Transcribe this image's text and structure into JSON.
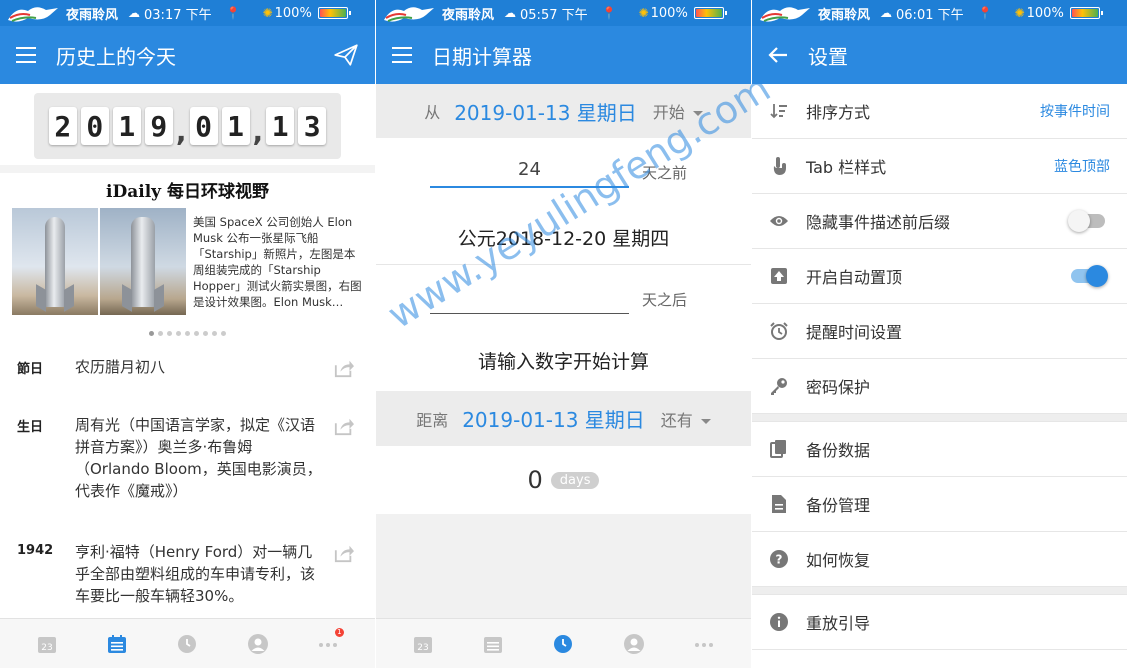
{
  "status_bars": [
    {
      "carrier": "夜雨聆风",
      "time": "03:17 下午",
      "battery": "100%"
    },
    {
      "carrier": "夜雨聆风",
      "time": "05:57 下午",
      "battery": "100%"
    },
    {
      "carrier": "夜雨聆风",
      "time": "06:01 下午",
      "battery": "100%"
    }
  ],
  "history": {
    "title": "历史上的今天",
    "date_digits": [
      "2",
      "0",
      "1",
      "9",
      "0",
      "1",
      "1",
      "3"
    ],
    "date_separator": ",",
    "card_title": "iDaily 每日环球视野",
    "card_text": "美国 SpaceX 公司创始人 Elon Musk 公布一张星际飞船「Starship」新照片，左图是本周组装完成的「Starship Hopper」测试火箭实景图，右图是设计效果图。Elon Musk…",
    "carousel": {
      "count": 9,
      "active": 0
    },
    "events": [
      {
        "label": "節日",
        "text": "农历腊月初八"
      },
      {
        "label": "生日",
        "text": "周有光（中国语言学家，拟定《汉语拼音方案》）奥兰多·布鲁姆（Orlando Bloom，英国电影演员，代表作《魔戒》）"
      },
      {
        "label": "1942",
        "text": "亨利·福特（Henry Ford）对一辆几乎全部由塑料组成的车申请专利，该车要比一般车辆轻30%。"
      }
    ],
    "nav_badge": "1"
  },
  "calculator": {
    "title": "日期计算器",
    "from_label": "从",
    "from_date": "2019-01-13 星期日",
    "from_mode": "开始",
    "before_value": "24",
    "before_suffix": "天之前",
    "result_date": "公元2018-12-20 星期四",
    "after_value": "",
    "after_suffix": "天之后",
    "prompt": "请输入数字开始计算",
    "distance_label": "距离",
    "distance_date": "2019-01-13 星期日",
    "distance_mode": "还有",
    "count": "0",
    "count_unit": "days",
    "watermark": "www.yeyulingfeng.com"
  },
  "settings": {
    "title": "设置",
    "rows": [
      {
        "label": "排序方式",
        "value": "按事件时间"
      },
      {
        "label": "Tab 栏样式",
        "value": "蓝色顶部"
      },
      {
        "label": "隐藏事件描述前后缀",
        "toggle": false
      },
      {
        "label": "开启自动置顶",
        "toggle": true
      },
      {
        "label": "提醒时间设置"
      },
      {
        "label": "密码保护"
      },
      {
        "label": "备份数据"
      },
      {
        "label": "备份管理"
      },
      {
        "label": "如何恢复"
      },
      {
        "label": "重放引导"
      }
    ]
  },
  "colors": {
    "primary": "#2b89e0",
    "status": "#1f7fd6",
    "badge": "#f44336"
  }
}
